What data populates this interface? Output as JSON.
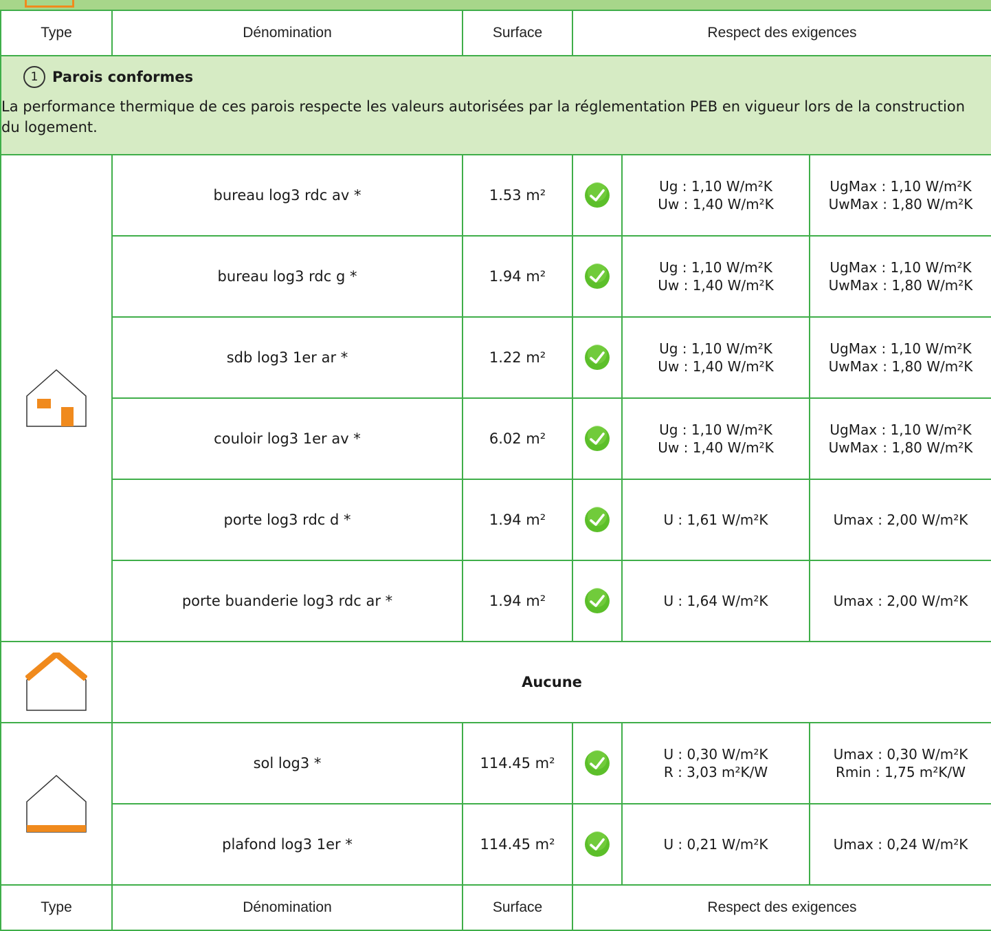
{
  "header": {
    "type": "Type",
    "denomination": "Dénomination",
    "surface": "Surface",
    "respect": "Respect des exigences"
  },
  "section": {
    "number": "1",
    "title": "Parois conformes",
    "description": "La performance thermique de ces parois respecte les valeurs autorisées par la réglementation PEB en vigueur lors de la construction du logement."
  },
  "rows": [
    {
      "name": "bureau log3 rdc av *",
      "surface": "1.53 m²",
      "val1": "Ug : 1,10 W/m²K",
      "val2": "Uw : 1,40 W/m²K",
      "max1": "UgMax : 1,10 W/m²K",
      "max2": "UwMax : 1,80 W/m²K"
    },
    {
      "name": "bureau log3 rdc g *",
      "surface": "1.94 m²",
      "val1": "Ug : 1,10 W/m²K",
      "val2": "Uw : 1,40 W/m²K",
      "max1": "UgMax : 1,10 W/m²K",
      "max2": "UwMax : 1,80 W/m²K"
    },
    {
      "name": "sdb log3 1er ar *",
      "surface": "1.22 m²",
      "val1": "Ug : 1,10 W/m²K",
      "val2": "Uw : 1,40 W/m²K",
      "max1": "UgMax : 1,10 W/m²K",
      "max2": "UwMax : 1,80 W/m²K"
    },
    {
      "name": "couloir log3 1er av *",
      "surface": "6.02 m²",
      "val1": "Ug : 1,10 W/m²K",
      "val2": "Uw : 1,40 W/m²K",
      "max1": "UgMax : 1,10 W/m²K",
      "max2": "UwMax : 1,80 W/m²K"
    },
    {
      "name": "porte log3 rdc d *",
      "surface": "1.94 m²",
      "val1": "U : 1,61 W/m²K",
      "val2": "",
      "max1": "Umax : 2,00 W/m²K",
      "max2": ""
    },
    {
      "name": "porte buanderie log3 rdc ar *",
      "surface": "1.94 m²",
      "val1": "U : 1,64 W/m²K",
      "val2": "",
      "max1": "Umax : 2,00 W/m²K",
      "max2": ""
    }
  ],
  "roof": {
    "text": "Aucune"
  },
  "floor_rows": [
    {
      "name": "sol log3 *",
      "surface": "114.45 m²",
      "val1": "U : 0,30 W/m²K",
      "val2": "R : 3,03 m²K/W",
      "max1": "Umax : 0,30 W/m²K",
      "max2": "Rmin : 1,75 m²K/W"
    },
    {
      "name": "plafond log3 1er *",
      "surface": "114.45 m²",
      "val1": "U : 0,21 W/m²K",
      "val2": "",
      "max1": "Umax : 0,24 W/m²K",
      "max2": ""
    }
  ],
  "footer": {
    "type": "Type",
    "denomination": "Dénomination",
    "surface": "Surface",
    "respect": "Respect des exigences"
  },
  "icons": {
    "window_type": "house-windows-icon",
    "roof_type": "house-roof-icon",
    "floor_type": "house-floor-icon",
    "ok": "check-ok-icon"
  },
  "colors": {
    "green_border": "#3fae49",
    "section_bg": "#d6ebc4",
    "orange": "#f08a1d",
    "check": "#5cbf2a"
  }
}
